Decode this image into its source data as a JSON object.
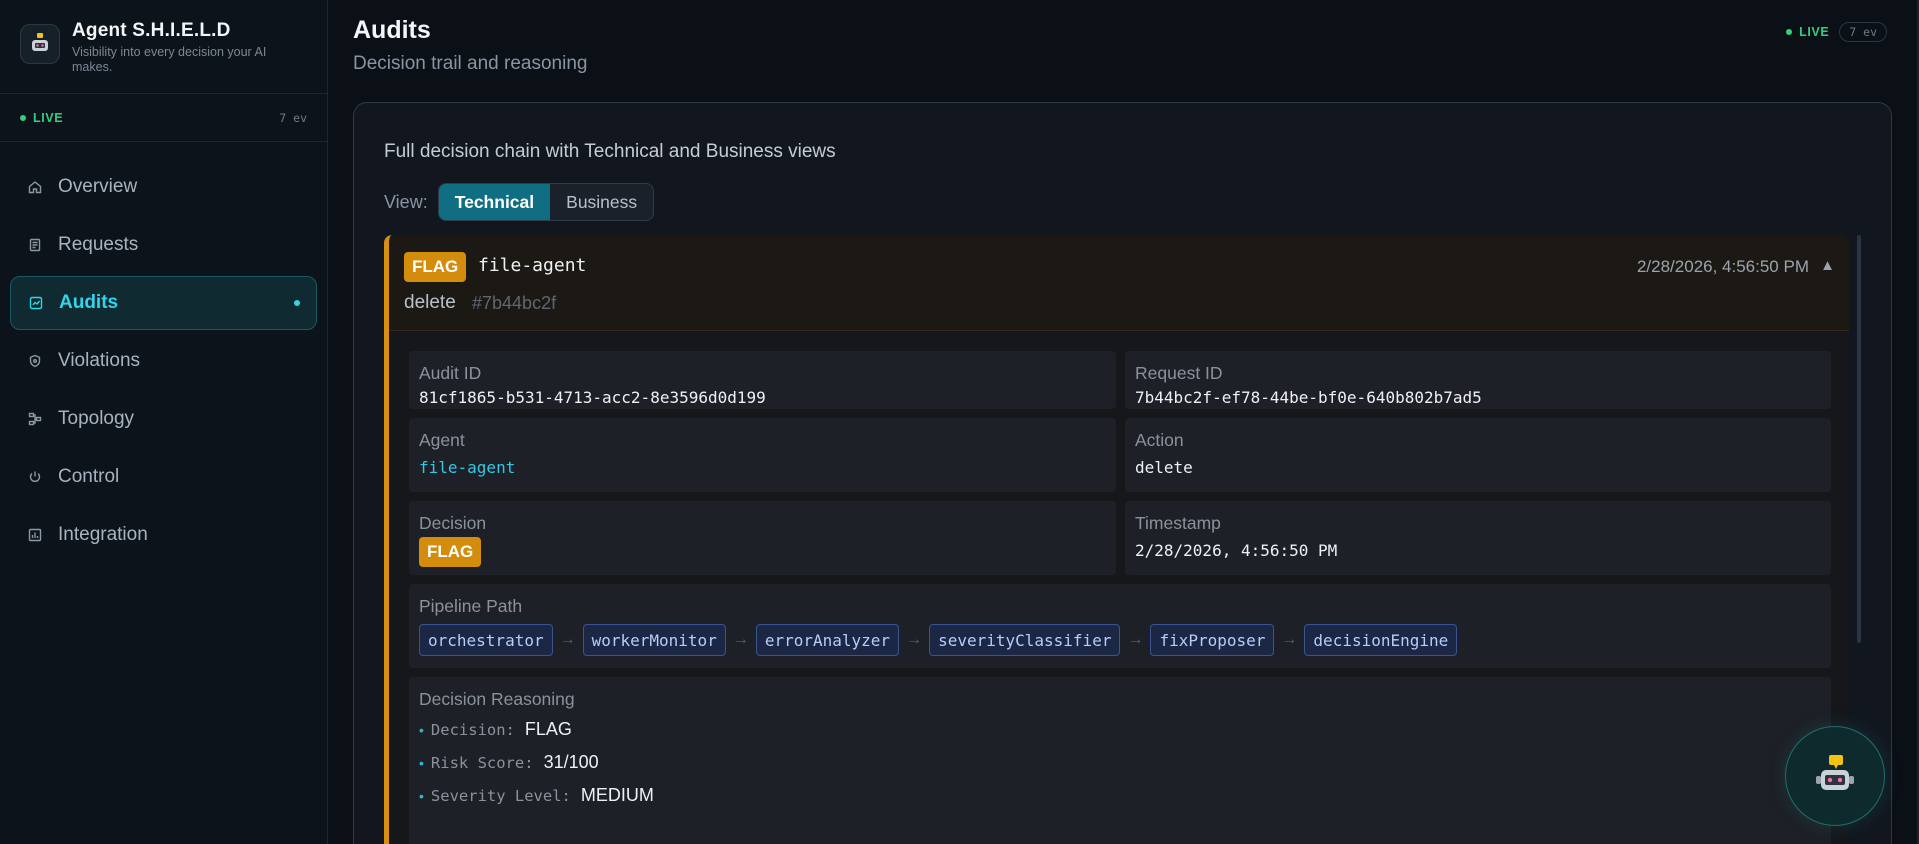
{
  "brand": {
    "title": "Agent S.H.I.E.L.D",
    "subtitle": "Visibility into every decision your AI makes."
  },
  "status": {
    "live_label": "LIVE",
    "event_count": "7 ev"
  },
  "sidebar": {
    "items": [
      {
        "label": "Overview",
        "icon": "home-icon",
        "active": false
      },
      {
        "label": "Requests",
        "icon": "document-icon",
        "active": false
      },
      {
        "label": "Audits",
        "icon": "audit-icon",
        "active": true
      },
      {
        "label": "Violations",
        "icon": "shield-icon",
        "active": false
      },
      {
        "label": "Topology",
        "icon": "topology-icon",
        "active": false
      },
      {
        "label": "Control",
        "icon": "power-icon",
        "active": false
      },
      {
        "label": "Integration",
        "icon": "chart-icon",
        "active": false
      }
    ]
  },
  "header": {
    "title": "Audits",
    "subtitle": "Decision trail and reasoning"
  },
  "panel": {
    "description": "Full decision chain with Technical and Business views",
    "view_label": "View:",
    "views": [
      "Technical",
      "Business"
    ],
    "selected_view": "Technical"
  },
  "audit": {
    "decision_badge": "FLAG",
    "agent": "file-agent",
    "action": "delete",
    "short_hash": "#7b44bc2f",
    "timestamp": "2/28/2026, 4:56:50 PM",
    "fields": {
      "audit_id_label": "Audit ID",
      "audit_id": "81cf1865-b531-4713-acc2-8e3596d0d199",
      "request_id_label": "Request ID",
      "request_id": "7b44bc2f-ef78-44be-bf0e-640b802b7ad5",
      "agent_label": "Agent",
      "agent": "file-agent",
      "action_label": "Action",
      "action": "delete",
      "decision_label": "Decision",
      "decision": "FLAG",
      "timestamp_label": "Timestamp",
      "timestamp": "2/28/2026, 4:56:50 PM"
    },
    "pipeline_label": "Pipeline Path",
    "pipeline": [
      "orchestrator",
      "workerMonitor",
      "errorAnalyzer",
      "severityClassifier",
      "fixProposer",
      "decisionEngine"
    ],
    "reasoning_label": "Decision Reasoning",
    "reasoning": [
      {
        "key": "Decision:",
        "value": "FLAG"
      },
      {
        "key": "Risk Score:",
        "value": "31/100"
      },
      {
        "key": "Severity Level:",
        "value": "MEDIUM"
      }
    ]
  },
  "colors": {
    "accent": "#33d5ea",
    "live": "#2fd07e",
    "flag": "#d38c0c",
    "chip_bg": "#1b2744"
  }
}
